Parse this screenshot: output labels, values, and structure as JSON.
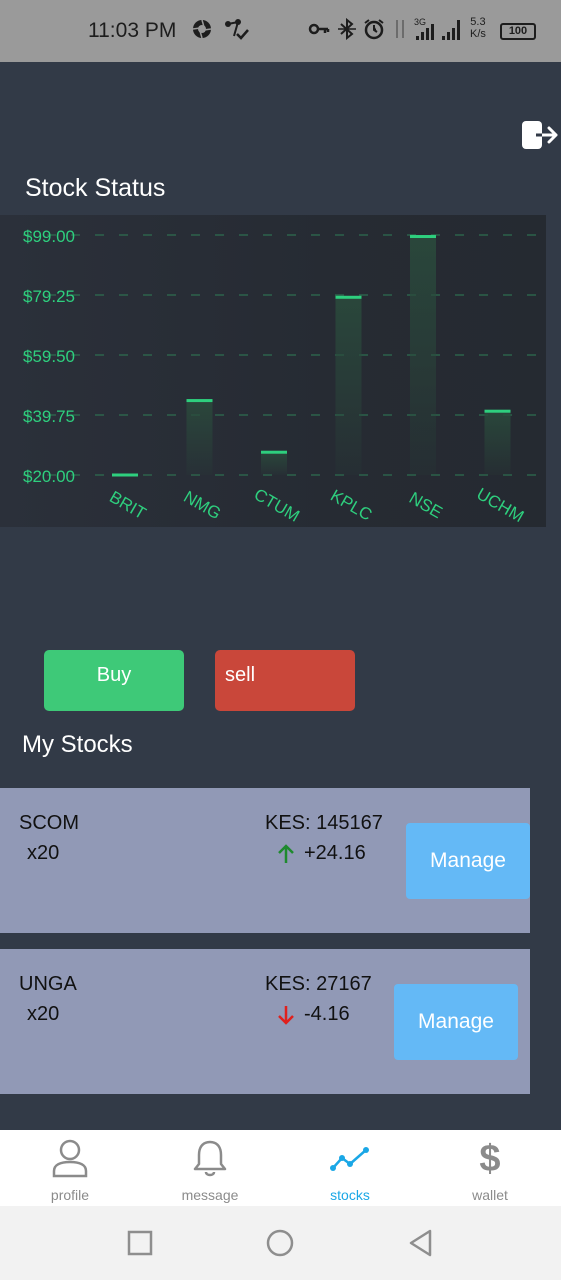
{
  "status_bar": {
    "time": "11:03 PM",
    "network_type": "3G",
    "speed_value": "5.3",
    "speed_unit": "K/s",
    "battery": "100"
  },
  "stock_status": {
    "title": "Stock Status"
  },
  "chart_data": {
    "type": "bar",
    "categories": [
      "BRIT",
      "NMG",
      "CTUM",
      "KPLC",
      "NSE",
      "UCHM"
    ],
    "values": [
      20.0,
      44.5,
      27.5,
      78.5,
      98.5,
      41.0
    ],
    "y_ticks": [
      "$99.00",
      "$79.25",
      "$59.50",
      "$39.75",
      "$20.00"
    ],
    "y_tick_values": [
      99.0,
      79.25,
      59.5,
      39.75,
      20.0
    ],
    "ylim": [
      20.0,
      99.0
    ],
    "grid": true,
    "colors": {
      "bar_top": "#2ecf7e",
      "bar_fill": "#2a4a3c",
      "label": "#2ecf7e",
      "grid": "#2e6e50"
    }
  },
  "actions": {
    "buy_label": "Buy",
    "sell_label": "sell"
  },
  "my_stocks": {
    "title": "My Stocks",
    "items": [
      {
        "symbol": "SCOM",
        "quantity": "x20",
        "price": "KES: 145167",
        "change": "+24.16",
        "direction": "up",
        "manage_label": "Manage"
      },
      {
        "symbol": "UNGA",
        "quantity": "x20",
        "price": "KES: 27167",
        "change": "-4.16",
        "direction": "down",
        "manage_label": "Manage"
      }
    ]
  },
  "bottom_nav": {
    "items": [
      {
        "label": "profile",
        "icon": "person-icon"
      },
      {
        "label": "message",
        "icon": "bell-icon"
      },
      {
        "label": "stocks",
        "icon": "trend-line-icon",
        "active": true
      },
      {
        "label": "wallet",
        "icon": "dollar-icon"
      }
    ]
  },
  "colors": {
    "background": "#323a47",
    "buy": "#3ec978",
    "sell": "#c9473a",
    "card": "#9199b6",
    "manage": "#64b9f6",
    "nav_active": "#1aa7e6",
    "up": "#1e8a2e",
    "down": "#e0201c"
  }
}
